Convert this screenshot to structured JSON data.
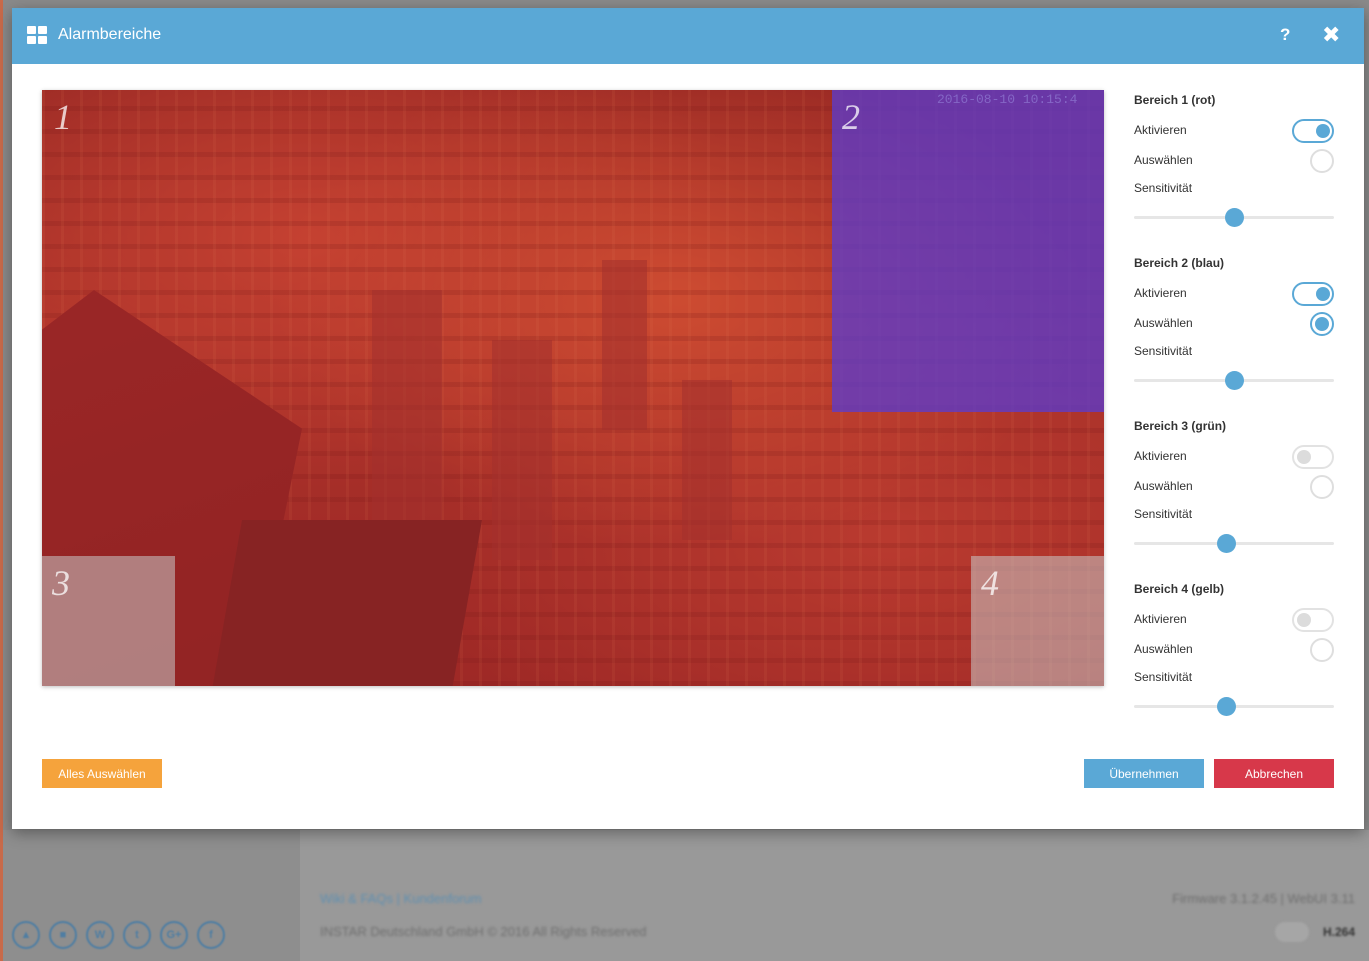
{
  "modal": {
    "title": "Alarmbereiche",
    "help_label": "?",
    "close_label": "✖"
  },
  "camera": {
    "timestamp": "2016-08-10 10:15:4",
    "areas": [
      {
        "number": "1",
        "color": "#be2828"
      },
      {
        "number": "2",
        "color": "#5a3cd2"
      },
      {
        "number": "3",
        "color": "#c8c8c8"
      },
      {
        "number": "4",
        "color": "#c8c8c8"
      }
    ]
  },
  "settings": {
    "labels": {
      "activate": "Aktivieren",
      "select": "Auswählen",
      "sensitivity": "Sensitivität"
    },
    "areas": [
      {
        "title": "Bereich 1 (rot)",
        "activate": true,
        "select": false,
        "sensitivity": 50
      },
      {
        "title": "Bereich 2 (blau)",
        "activate": true,
        "select": true,
        "sensitivity": 50
      },
      {
        "title": "Bereich 3 (grün)",
        "activate": false,
        "select": false,
        "sensitivity": 46
      },
      {
        "title": "Bereich 4 (gelb)",
        "activate": false,
        "select": false,
        "sensitivity": 46
      }
    ]
  },
  "buttons": {
    "select_all": "Alles Auswählen",
    "apply": "Übernehmen",
    "cancel": "Abbrechen"
  },
  "background_page": {
    "links": "Wiki & FAQs | Kundenforum",
    "copyright": "INSTAR Deutschland GmbH © 2016 All Rights Reserved",
    "firmware": "Firmware 3.1.2.45 | WebUI 3.11",
    "codec": "H.264",
    "social_icons": [
      "upload-icon",
      "camera-icon",
      "wiki-icon",
      "twitter-icon",
      "google-plus-icon",
      "facebook-icon"
    ],
    "social_glyphs": [
      "▲",
      "■",
      "W",
      "t",
      "G+",
      "f"
    ]
  },
  "colors": {
    "accent": "#5aa8d6",
    "orange": "#f5a33c",
    "danger": "#d7384a"
  }
}
